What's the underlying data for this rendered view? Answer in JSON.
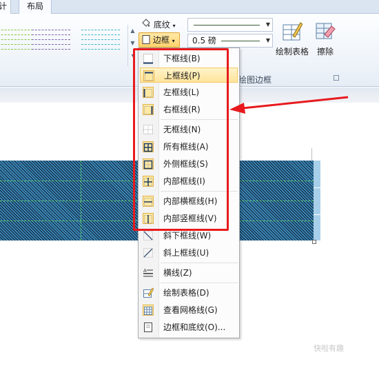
{
  "ribbon": {
    "tabs": [
      {
        "label": "计"
      },
      {
        "label": "布局"
      }
    ],
    "shading_label": "底纹",
    "borders_label": "边框",
    "pen_weight": "0.5 磅",
    "draw_table_label": "绘制表格",
    "eraser_label": "擦除",
    "group_label": "绘图边框"
  },
  "menu": {
    "items": [
      {
        "label": "下框线(B)",
        "icon": "bottom-border-icon"
      },
      {
        "label": "上框线(P)",
        "icon": "top-border-icon"
      },
      {
        "label": "左框线(L)",
        "icon": "left-border-icon"
      },
      {
        "label": "右框线(R)",
        "icon": "right-border-icon"
      },
      {
        "label": "无框线(N)",
        "icon": "no-border-icon"
      },
      {
        "label": "所有框线(A)",
        "icon": "all-borders-icon"
      },
      {
        "label": "外侧框线(S)",
        "icon": "outside-borders-icon"
      },
      {
        "label": "内部框线(I)",
        "icon": "inside-borders-icon"
      },
      {
        "label": "内部横框线(H)",
        "icon": "inside-horizontal-border-icon"
      },
      {
        "label": "内部竖框线(V)",
        "icon": "inside-vertical-border-icon"
      },
      {
        "label": "斜下框线(W)",
        "icon": "diagonal-down-border-icon"
      },
      {
        "label": "斜上框线(U)",
        "icon": "diagonal-up-border-icon"
      },
      {
        "label": "横线(Z)",
        "icon": "horizontal-line-icon"
      },
      {
        "label": "绘制表格(D)",
        "icon": "draw-table-icon"
      },
      {
        "label": "查看网格线(G)",
        "icon": "view-gridlines-icon"
      },
      {
        "label": "边框和底纹(O)...",
        "icon": "borders-shading-icon"
      }
    ]
  },
  "watermark": "快啦有趣",
  "colors": {
    "highlight": "#ffe49a",
    "annotation_red": "#e8191d",
    "table_fill": "#1a5a84"
  }
}
